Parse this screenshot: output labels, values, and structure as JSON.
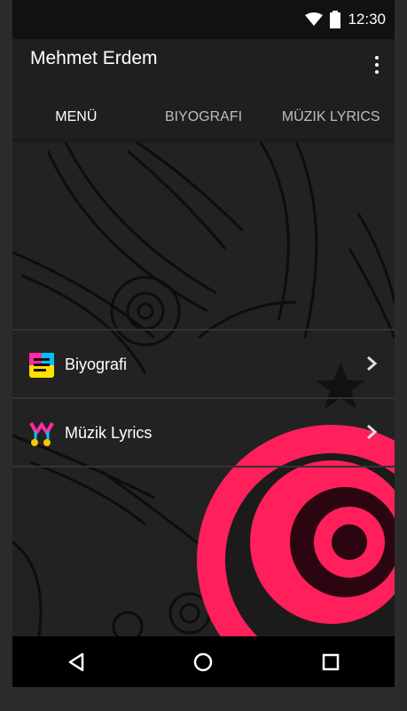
{
  "status_bar": {
    "time": "12:30"
  },
  "app_bar": {
    "title": "Mehmet Erdem",
    "tabs": [
      {
        "label": "MENÜ",
        "active": true
      },
      {
        "label": "BIYOGRAFI",
        "active": false
      },
      {
        "label": "MÜZIK LYRICS",
        "active": false
      }
    ]
  },
  "menu": {
    "items": [
      {
        "label": "Biyografi",
        "icon": "biography-icon"
      },
      {
        "label": "Müzik Lyrics",
        "icon": "music-icon"
      }
    ]
  },
  "nav": {
    "back": "back-icon",
    "home": "home-icon",
    "recents": "recents-icon"
  },
  "colors": {
    "accent": "#ff1f5a",
    "background": "#222222",
    "appbar": "#1f1f1f"
  }
}
